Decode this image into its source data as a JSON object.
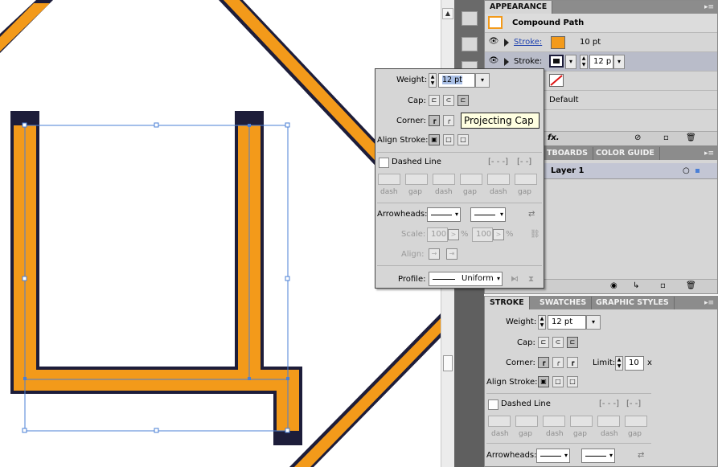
{
  "colors": {
    "orange": "#f39a1a",
    "navy": "#1d1d3a",
    "selection": "#4a7fd6"
  },
  "appearance": {
    "tab": "APPEARANCE",
    "object": "Compound Path",
    "stroke1": {
      "label": "Stroke:",
      "weight": "10 pt",
      "color": "#f39a1a"
    },
    "stroke2": {
      "label": "Stroke:",
      "weight": "12 p",
      "color": "#1d1d3a"
    },
    "opacity": "Default",
    "fx": "fx."
  },
  "layers": {
    "tabs": [
      "TBOARDS",
      "COLOR GUIDE"
    ],
    "layer1": "Layer 1"
  },
  "flyout": {
    "weight_label": "Weight:",
    "weight_value": "12 pt",
    "cap_label": "Cap:",
    "corner_label": "Corner:",
    "align_label": "Align Stroke:",
    "dashed": "Dashed Line",
    "dash_labels": [
      "dash",
      "gap",
      "dash",
      "gap",
      "dash",
      "gap"
    ],
    "arrowheads": "Arrowheads:",
    "scale": "Scale:",
    "scale1": "100",
    "scale2": "100",
    "pct": "%",
    "align": "Align:",
    "profile": "Profile:",
    "profile_value": "Uniform"
  },
  "tooltip": "Projecting Cap",
  "stroke_panel": {
    "tabs": [
      "STROKE",
      "SWATCHES",
      "GRAPHIC STYLES"
    ],
    "weight_label": "Weight:",
    "weight_value": "12 pt",
    "cap_label": "Cap:",
    "corner_label": "Corner:",
    "limit_label": "Limit:",
    "limit_value": "10",
    "limit_unit": "x",
    "align_label": "Align Stroke:",
    "dashed": "Dashed Line",
    "dash_labels": [
      "dash",
      "gap",
      "dash",
      "gap",
      "dash",
      "gap"
    ],
    "arrowheads": "Arrowheads:"
  }
}
